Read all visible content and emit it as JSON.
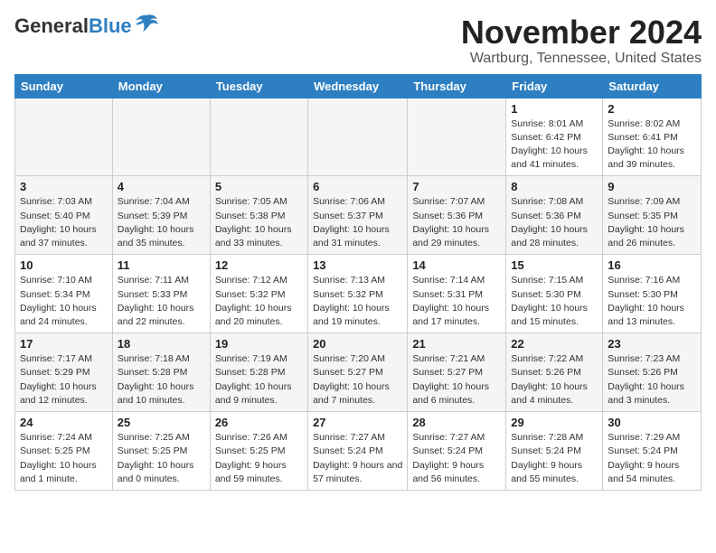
{
  "header": {
    "logo_general": "General",
    "logo_blue": "Blue",
    "month": "November 2024",
    "location": "Wartburg, Tennessee, United States"
  },
  "weekdays": [
    "Sunday",
    "Monday",
    "Tuesday",
    "Wednesday",
    "Thursday",
    "Friday",
    "Saturday"
  ],
  "weeks": [
    [
      {
        "day": "",
        "empty": true
      },
      {
        "day": "",
        "empty": true
      },
      {
        "day": "",
        "empty": true
      },
      {
        "day": "",
        "empty": true
      },
      {
        "day": "",
        "empty": true
      },
      {
        "day": "1",
        "sunrise": "Sunrise: 8:01 AM",
        "sunset": "Sunset: 6:42 PM",
        "daylight": "Daylight: 10 hours and 41 minutes."
      },
      {
        "day": "2",
        "sunrise": "Sunrise: 8:02 AM",
        "sunset": "Sunset: 6:41 PM",
        "daylight": "Daylight: 10 hours and 39 minutes."
      }
    ],
    [
      {
        "day": "3",
        "sunrise": "Sunrise: 7:03 AM",
        "sunset": "Sunset: 5:40 PM",
        "daylight": "Daylight: 10 hours and 37 minutes."
      },
      {
        "day": "4",
        "sunrise": "Sunrise: 7:04 AM",
        "sunset": "Sunset: 5:39 PM",
        "daylight": "Daylight: 10 hours and 35 minutes."
      },
      {
        "day": "5",
        "sunrise": "Sunrise: 7:05 AM",
        "sunset": "Sunset: 5:38 PM",
        "daylight": "Daylight: 10 hours and 33 minutes."
      },
      {
        "day": "6",
        "sunrise": "Sunrise: 7:06 AM",
        "sunset": "Sunset: 5:37 PM",
        "daylight": "Daylight: 10 hours and 31 minutes."
      },
      {
        "day": "7",
        "sunrise": "Sunrise: 7:07 AM",
        "sunset": "Sunset: 5:36 PM",
        "daylight": "Daylight: 10 hours and 29 minutes."
      },
      {
        "day": "8",
        "sunrise": "Sunrise: 7:08 AM",
        "sunset": "Sunset: 5:36 PM",
        "daylight": "Daylight: 10 hours and 28 minutes."
      },
      {
        "day": "9",
        "sunrise": "Sunrise: 7:09 AM",
        "sunset": "Sunset: 5:35 PM",
        "daylight": "Daylight: 10 hours and 26 minutes."
      }
    ],
    [
      {
        "day": "10",
        "sunrise": "Sunrise: 7:10 AM",
        "sunset": "Sunset: 5:34 PM",
        "daylight": "Daylight: 10 hours and 24 minutes."
      },
      {
        "day": "11",
        "sunrise": "Sunrise: 7:11 AM",
        "sunset": "Sunset: 5:33 PM",
        "daylight": "Daylight: 10 hours and 22 minutes."
      },
      {
        "day": "12",
        "sunrise": "Sunrise: 7:12 AM",
        "sunset": "Sunset: 5:32 PM",
        "daylight": "Daylight: 10 hours and 20 minutes."
      },
      {
        "day": "13",
        "sunrise": "Sunrise: 7:13 AM",
        "sunset": "Sunset: 5:32 PM",
        "daylight": "Daylight: 10 hours and 19 minutes."
      },
      {
        "day": "14",
        "sunrise": "Sunrise: 7:14 AM",
        "sunset": "Sunset: 5:31 PM",
        "daylight": "Daylight: 10 hours and 17 minutes."
      },
      {
        "day": "15",
        "sunrise": "Sunrise: 7:15 AM",
        "sunset": "Sunset: 5:30 PM",
        "daylight": "Daylight: 10 hours and 15 minutes."
      },
      {
        "day": "16",
        "sunrise": "Sunrise: 7:16 AM",
        "sunset": "Sunset: 5:30 PM",
        "daylight": "Daylight: 10 hours and 13 minutes."
      }
    ],
    [
      {
        "day": "17",
        "sunrise": "Sunrise: 7:17 AM",
        "sunset": "Sunset: 5:29 PM",
        "daylight": "Daylight: 10 hours and 12 minutes."
      },
      {
        "day": "18",
        "sunrise": "Sunrise: 7:18 AM",
        "sunset": "Sunset: 5:28 PM",
        "daylight": "Daylight: 10 hours and 10 minutes."
      },
      {
        "day": "19",
        "sunrise": "Sunrise: 7:19 AM",
        "sunset": "Sunset: 5:28 PM",
        "daylight": "Daylight: 10 hours and 9 minutes."
      },
      {
        "day": "20",
        "sunrise": "Sunrise: 7:20 AM",
        "sunset": "Sunset: 5:27 PM",
        "daylight": "Daylight: 10 hours and 7 minutes."
      },
      {
        "day": "21",
        "sunrise": "Sunrise: 7:21 AM",
        "sunset": "Sunset: 5:27 PM",
        "daylight": "Daylight: 10 hours and 6 minutes."
      },
      {
        "day": "22",
        "sunrise": "Sunrise: 7:22 AM",
        "sunset": "Sunset: 5:26 PM",
        "daylight": "Daylight: 10 hours and 4 minutes."
      },
      {
        "day": "23",
        "sunrise": "Sunrise: 7:23 AM",
        "sunset": "Sunset: 5:26 PM",
        "daylight": "Daylight: 10 hours and 3 minutes."
      }
    ],
    [
      {
        "day": "24",
        "sunrise": "Sunrise: 7:24 AM",
        "sunset": "Sunset: 5:25 PM",
        "daylight": "Daylight: 10 hours and 1 minute."
      },
      {
        "day": "25",
        "sunrise": "Sunrise: 7:25 AM",
        "sunset": "Sunset: 5:25 PM",
        "daylight": "Daylight: 10 hours and 0 minutes."
      },
      {
        "day": "26",
        "sunrise": "Sunrise: 7:26 AM",
        "sunset": "Sunset: 5:25 PM",
        "daylight": "Daylight: 9 hours and 59 minutes."
      },
      {
        "day": "27",
        "sunrise": "Sunrise: 7:27 AM",
        "sunset": "Sunset: 5:24 PM",
        "daylight": "Daylight: 9 hours and 57 minutes."
      },
      {
        "day": "28",
        "sunrise": "Sunrise: 7:27 AM",
        "sunset": "Sunset: 5:24 PM",
        "daylight": "Daylight: 9 hours and 56 minutes."
      },
      {
        "day": "29",
        "sunrise": "Sunrise: 7:28 AM",
        "sunset": "Sunset: 5:24 PM",
        "daylight": "Daylight: 9 hours and 55 minutes."
      },
      {
        "day": "30",
        "sunrise": "Sunrise: 7:29 AM",
        "sunset": "Sunset: 5:24 PM",
        "daylight": "Daylight: 9 hours and 54 minutes."
      }
    ]
  ]
}
